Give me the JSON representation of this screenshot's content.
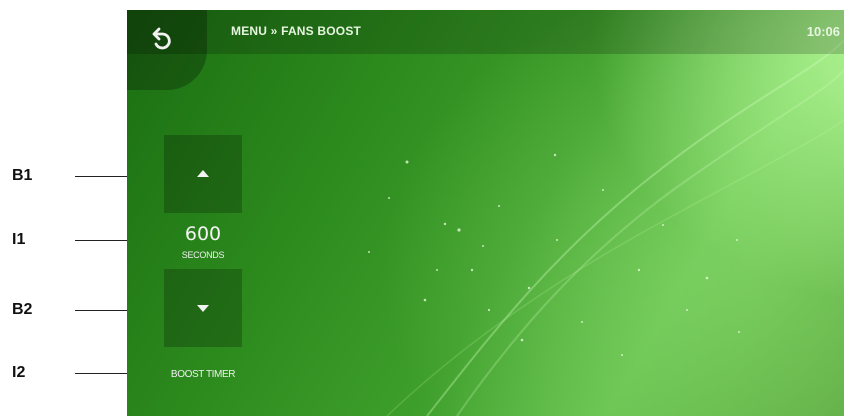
{
  "annotations": [
    {
      "id": "B1",
      "label": "B1"
    },
    {
      "id": "I1",
      "label": "I1"
    },
    {
      "id": "B2",
      "label": "B2"
    },
    {
      "id": "I2",
      "label": "I2"
    }
  ],
  "header": {
    "breadcrumb": "MENU » FANS BOOST",
    "time": "10:06"
  },
  "control": {
    "value": "600",
    "unit": "SECONDS",
    "caption": "BOOST TIMER"
  },
  "icons": {
    "back": "back-arrow-icon",
    "up": "arrow-up-icon",
    "down": "arrow-down-icon"
  },
  "colors": {
    "background_dark": "#1b6e12",
    "background_light": "#a6f08a",
    "text": "#f0f0f0"
  }
}
